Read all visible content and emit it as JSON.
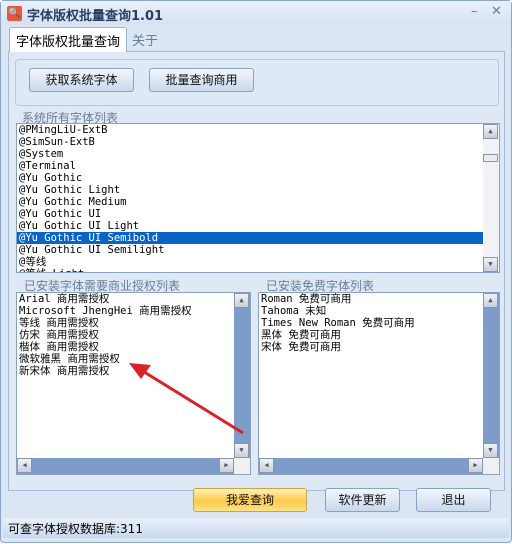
{
  "window": {
    "title": "字体版权批量查询1.01",
    "minimize": "–",
    "close": "✕",
    "app_icon": "search-icon"
  },
  "tabs": [
    {
      "label": "字体版权批量查询",
      "active": true
    },
    {
      "label": "关于",
      "active": false
    }
  ],
  "toolbar": {
    "get_fonts": "获取系统字体",
    "batch_query": "批量查询商用"
  },
  "system_fonts": {
    "label": "系统所有字体列表",
    "items": [
      "@PMingLiU-ExtB",
      "@SimSun-ExtB",
      "@System",
      "@Terminal",
      "@Yu Gothic",
      "@Yu Gothic Light",
      "@Yu Gothic Medium",
      "@Yu Gothic UI",
      "@Yu Gothic UI Light",
      "@Yu Gothic UI Semibold",
      "@Yu Gothic UI Semilight",
      "@等线",
      "@等线 Light"
    ],
    "selected": "@Yu Gothic UI Semibold"
  },
  "commercial": {
    "label": "已安装字体需要商业授权列表",
    "items": [
      "Arial 商用需授权",
      "Microsoft JhengHei 商用需授权",
      "等线 商用需授权",
      "仿宋 商用需授权",
      "楷体 商用需授权",
      "微软雅黑 商用需授权",
      "新宋体 商用需授权"
    ]
  },
  "free": {
    "label": "已安装免费字体列表",
    "items": [
      "Roman 免费可商用",
      "Tahoma 未知",
      "Times New Roman 免费可商用",
      "黑体 免费可商用",
      "宋体 免费可商用"
    ]
  },
  "buttons": {
    "query": "我爱查询",
    "update": "软件更新",
    "exit": "退出"
  },
  "status": "可查字体授权数据库:311",
  "colors": {
    "selection": "#0a64c8",
    "accent_button": "#fcc94a",
    "arrow": "#d9222a"
  }
}
